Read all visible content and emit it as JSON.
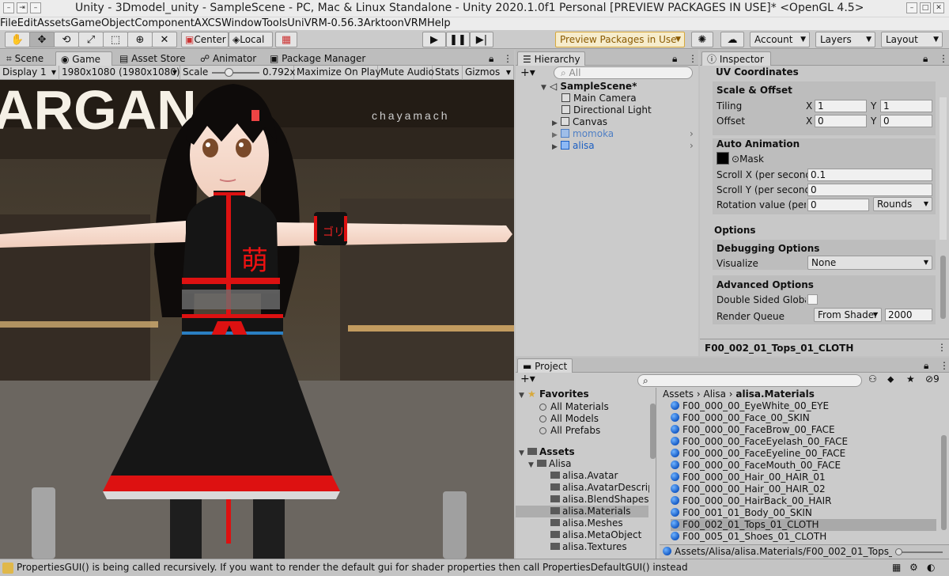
{
  "window": {
    "title": "Unity - 3Dmodel_unity - SampleScene - PC, Mac & Linux Standalone - Unity 2020.1.0f1 Personal [PREVIEW PACKAGES IN USE]* <OpenGL 4.5>",
    "controls": [
      "–",
      "⇥",
      "–",
      "□",
      "✕"
    ]
  },
  "menu": [
    "File",
    "Edit",
    "Assets",
    "GameObject",
    "Component",
    "AXCS",
    "Window",
    "Tools",
    "UniVRM-0.56.3",
    "Arktoon",
    "VRM",
    "Help"
  ],
  "toolbar": {
    "center_label": "Center",
    "local_label": "Local",
    "preview_packages": "Preview Packages in Use",
    "account": "Account",
    "layers": "Layers",
    "layout": "Layout"
  },
  "scene_tabs": [
    "Scene",
    "Game",
    "Asset Store",
    "Animator",
    "Package Manager"
  ],
  "game_bar": {
    "display": "Display 1",
    "resolution": "1980x1080 (1980x1080)",
    "scale_label": "Scale",
    "scale_value": "0.792x",
    "scale_fraction": 0.35,
    "maximize": "Maximize On Play",
    "mute": "Mute Audio",
    "stats": "Stats",
    "gizmos": "Gizmos"
  },
  "game_view": {
    "sign_text": "ARGAN",
    "sign_sub": "chayamach",
    "armband_text": "ゴリ",
    "chest_text": "萌"
  },
  "hierarchy": {
    "tab": "Hierarchy",
    "search_placeholder": "All",
    "items": [
      {
        "label": "SampleScene*",
        "level": 0
      },
      {
        "label": "Main Camera",
        "level": 1
      },
      {
        "label": "Directional Light",
        "level": 1
      },
      {
        "label": "Canvas",
        "level": 1
      },
      {
        "label": "momoka",
        "level": 1
      },
      {
        "label": "alisa",
        "level": 1
      }
    ]
  },
  "inspector": {
    "tab": "Inspector",
    "uv_header": "UV Coordinates",
    "scale_offset_header": "Scale & Offset",
    "tiling_label": "Tiling",
    "offset_label": "Offset",
    "x": "X",
    "y": "Y",
    "tiling_x": "1",
    "tiling_y": "1",
    "offset_x": "0",
    "offset_y": "0",
    "auto_anim_header": "Auto Animation",
    "mask_label": "Mask",
    "scroll_x_label": "Scroll X (per second)",
    "scroll_x_value": "0.1",
    "scroll_y_label": "Scroll Y (per second)",
    "scroll_y_value": "0",
    "rotation_label": "Rotation value (per se",
    "rotation_value": "0",
    "rotation_mode": "Rounds",
    "options_header": "Options",
    "debug_header": "Debugging Options",
    "visualize_label": "Visualize",
    "visualize_value": "None",
    "advanced_header": "Advanced Options",
    "double_sided_label": "Double Sided Global I",
    "render_queue_label": "Render Queue",
    "render_queue_mode": "From Shader",
    "render_queue_value": "2000",
    "preview_title": "F00_002_01_Tops_01_CLOTH"
  },
  "project": {
    "tab": "Project",
    "hidden_count": "9",
    "favorites_label": "Favorites",
    "favorites": [
      "All Materials",
      "All Models",
      "All Prefabs"
    ],
    "assets_label": "Assets",
    "tree": [
      {
        "label": "Alisa",
        "level": 1
      },
      {
        "label": "alisa.Avatar",
        "level": 2
      },
      {
        "label": "alisa.AvatarDescripti",
        "level": 2
      },
      {
        "label": "alisa.BlendShapes",
        "level": 2
      },
      {
        "label": "alisa.Materials",
        "level": 2
      },
      {
        "label": "alisa.Meshes",
        "level": 2
      },
      {
        "label": "alisa.MetaObject",
        "level": 2
      },
      {
        "label": "alisa.Textures",
        "level": 2
      }
    ],
    "breadcrumb": [
      "Assets",
      "Alisa",
      "alisa.Materials"
    ],
    "materials": [
      "F00_000_00_EyeWhite_00_EYE",
      "F00_000_00_Face_00_SKIN",
      "F00_000_00_FaceBrow_00_FACE",
      "F00_000_00_FaceEyelash_00_FACE",
      "F00_000_00_FaceEyeline_00_FACE",
      "F00_000_00_FaceMouth_00_FACE",
      "F00_000_00_Hair_00_HAIR_01",
      "F00_000_00_Hair_00_HAIR_02",
      "F00_000_00_HairBack_00_HAIR",
      "F00_001_01_Body_00_SKIN",
      "F00_002_01_Tops_01_CLOTH",
      "F00_005_01_Shoes_01_CLOTH"
    ],
    "selected_path": "Assets/Alisa/alisa.Materials/F00_002_01_Tops_01_C"
  },
  "status": {
    "message": "PropertiesGUI() is being called recursively. If you want to render the default gui for shader properties then call PropertiesDefaultGUI() instead"
  },
  "colors": {
    "accent_blue": "#1c5fc2",
    "preview_text": "#8a5a00",
    "preview_border": "#d8a93b"
  }
}
